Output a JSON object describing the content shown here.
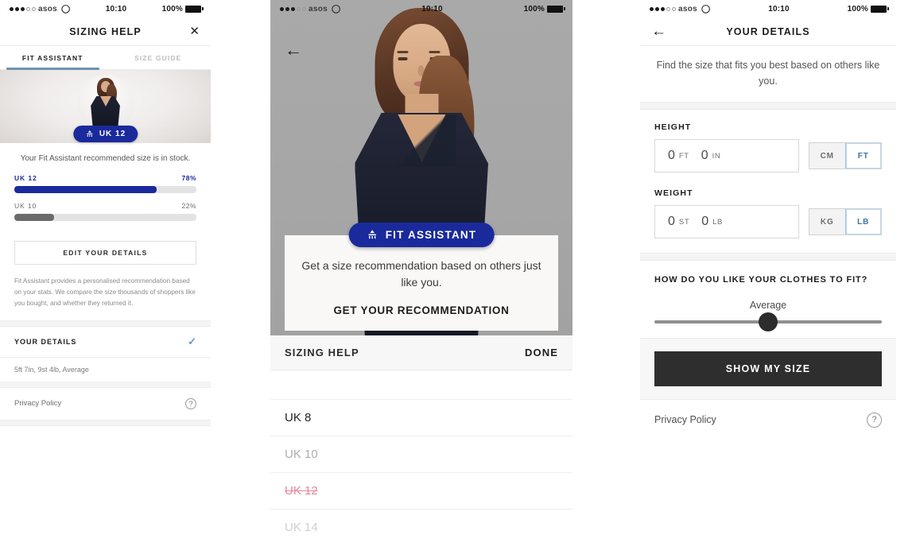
{
  "status_bar": {
    "carrier": "asos",
    "time": "10:10",
    "battery_pct": "100%",
    "wifi_icon": "wifi-icon",
    "signal_dots_filled": 3,
    "signal_dots_total": 5
  },
  "panel1": {
    "nav": {
      "title": "SIZING HELP",
      "close_icon": "close-icon"
    },
    "tabs": [
      {
        "label": "FIT ASSISTANT",
        "active": true
      },
      {
        "label": "SIZE GUIDE",
        "active": false
      }
    ],
    "hero": {
      "badge_label": "UK 12",
      "badge_icon": "fit-assistant-icon",
      "badge_color": "#1a2a9c",
      "avatar_icon": "model-avatar"
    },
    "description": "Your Fit Assistant recommended size is in stock.",
    "size_bars": [
      {
        "label": "UK 12",
        "percent_label": "78%",
        "percent": 78,
        "color": "#1a2a9c"
      },
      {
        "label": "UK 10",
        "percent_label": "22%",
        "percent": 22,
        "color": "#6b6b6b"
      }
    ],
    "edit_button": "EDIT YOUR DETAILS",
    "legal": "Fit Assistant provides a personalised recommendation based on your stats. We compare the size thousands of shoppers like you bought, and whether they returned it.",
    "your_details": {
      "title": "YOUR DETAILS",
      "check_icon": "check-icon",
      "check_color": "#5b9bd5",
      "summary": "5ft 7in, 9st 4lb, Average"
    },
    "privacy": {
      "label": "Privacy Policy",
      "icon": "question-mark-icon"
    }
  },
  "panel2": {
    "back_icon": "back-arrow-icon",
    "card": {
      "badge_label": "FIT ASSISTANT",
      "badge_icon": "fit-assistant-icon",
      "body": "Get a size recommendation based on others just like you.",
      "cta": "GET YOUR RECOMMENDATION"
    },
    "bottom_bar": {
      "title": "SIZING HELP",
      "done": "DONE"
    },
    "sizes": [
      {
        "label": "UK 8",
        "state": "active"
      },
      {
        "label": "UK 10",
        "state": "available"
      },
      {
        "label": "UK 12",
        "state": "unavailable"
      },
      {
        "label": "UK 14",
        "state": "faded"
      }
    ]
  },
  "panel3": {
    "nav": {
      "title": "YOUR DETAILS",
      "back_icon": "back-arrow-icon"
    },
    "intro": "Find the size that fits you best based on others like you.",
    "height": {
      "label": "HEIGHT",
      "value_major": "0",
      "unit_major": "FT",
      "value_minor": "0",
      "unit_minor": "IN",
      "toggle": [
        {
          "label": "CM",
          "selected": false
        },
        {
          "label": "FT",
          "selected": true
        }
      ]
    },
    "weight": {
      "label": "WEIGHT",
      "value_major": "0",
      "unit_major": "ST",
      "value_minor": "0",
      "unit_minor": "LB",
      "toggle": [
        {
          "label": "KG",
          "selected": false
        },
        {
          "label": "LB",
          "selected": true
        }
      ]
    },
    "fit_question": "HOW DO YOU LIKE YOUR CLOTHES TO FIT?",
    "fit_value": "Average",
    "fit_slider_percent": 50,
    "cta": "SHOW MY SIZE",
    "privacy": {
      "label": "Privacy Policy",
      "icon": "question-mark-icon"
    }
  }
}
